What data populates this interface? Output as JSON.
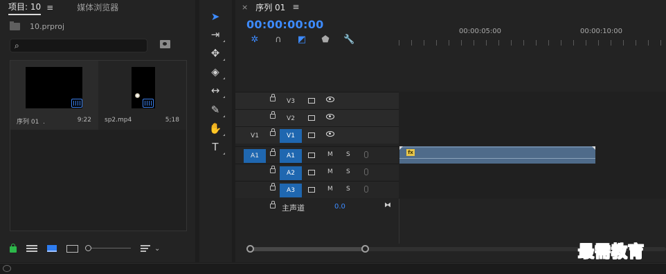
{
  "project_panel": {
    "tab_project": "项目: 10",
    "tab_menu": "≡",
    "tab_media_browser": "媒体浏览器",
    "project_file": "10.prproj",
    "search": {
      "value": "",
      "glyph": "⌕"
    },
    "clips": [
      {
        "name": "序列 01",
        "dot": ".",
        "duration": "9:22",
        "icon": "sequence-icon"
      },
      {
        "name": "sp2.mp4",
        "duration": "5;18",
        "icon": "video-icon"
      }
    ]
  },
  "tools": [
    {
      "name": "selection-tool",
      "glyph": "➤",
      "active": true
    },
    {
      "name": "track-select-tool",
      "glyph": "⇥"
    },
    {
      "name": "ripple-edit-tool",
      "glyph": "✥"
    },
    {
      "name": "razor-tool",
      "glyph": "◈"
    },
    {
      "name": "slip-tool",
      "glyph": "↔"
    },
    {
      "name": "pen-tool",
      "glyph": "✎"
    },
    {
      "name": "hand-tool",
      "glyph": "✋"
    },
    {
      "name": "type-tool",
      "glyph": "T"
    }
  ],
  "timeline": {
    "close": "×",
    "sequence_title": "序列 01",
    "menu": "≡",
    "timecode": "00:00:00:00",
    "ruler_labels": [
      "00:00:05:00",
      "00:00:10:00"
    ],
    "toolbar_icons": [
      "snap-icon",
      "linked-selection-icon",
      "add-marker-target-icon",
      "marker-icon",
      "wrench-icon"
    ],
    "toolbar_glyphs": [
      "✲",
      "∩",
      "◩",
      "⬟",
      "🔧"
    ],
    "video_tracks": [
      {
        "source": "",
        "name": "V3"
      },
      {
        "source": "",
        "name": "V2"
      },
      {
        "source": "V1",
        "name": "V1"
      }
    ],
    "audio_tracks": [
      {
        "source": "A1",
        "name": "A1",
        "m": "M",
        "s": "S"
      },
      {
        "source": "",
        "name": "A2",
        "m": "M",
        "s": "S"
      },
      {
        "source": "",
        "name": "A3",
        "m": "M",
        "s": "S"
      }
    ],
    "master": {
      "label": "主声道",
      "value": "0.0",
      "end_glyph": "⧓"
    },
    "clip_fx_label": "fx"
  },
  "watermark": "最需教育",
  "colors": {
    "accent": "#3d8bff",
    "track_target": "#1f67b0",
    "clip": "#4f6b8a",
    "lock_green": "#2db84a"
  }
}
